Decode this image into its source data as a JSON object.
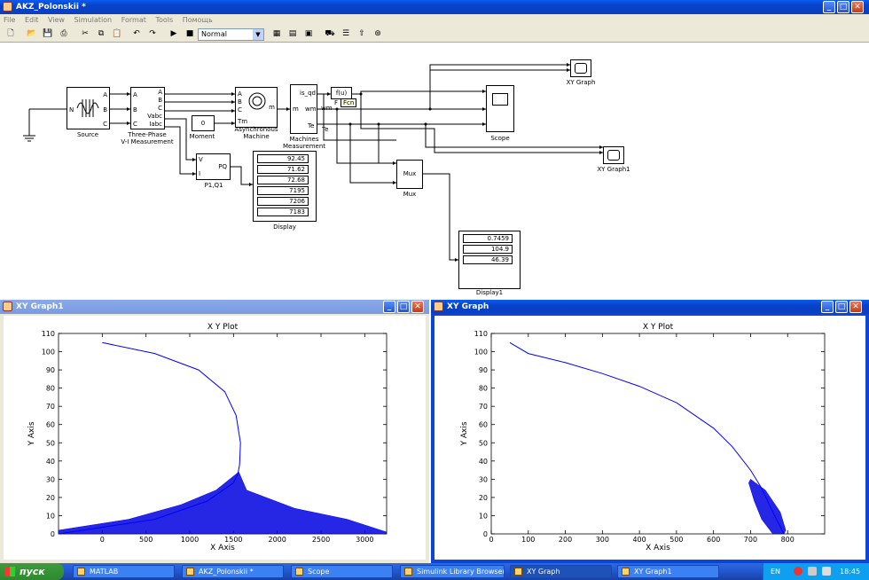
{
  "model_window": {
    "title": "AKZ_Polonskii *",
    "menu": [
      "File",
      "Edit",
      "View",
      "Simulation",
      "Format",
      "Tools",
      "Помощь"
    ],
    "sim_mode": "Normal",
    "blocks": {
      "source": {
        "label": "Source",
        "ports": [
          "N",
          "A",
          "B",
          "C"
        ]
      },
      "vi_meas": {
        "label": "Three-Phase\nV-I Measurement",
        "label_line1": "Three-Phase",
        "label_line2": "V-I Measurement",
        "ports_in": [
          "A",
          "B",
          "C"
        ],
        "ports_out": [
          "A",
          "B",
          "C",
          "Vabc",
          "Iabc"
        ]
      },
      "moment": {
        "label": "Moment",
        "value": "0"
      },
      "async_machine": {
        "label_line1": "Asynchronous",
        "label_line2": "Machine",
        "ports": [
          "A",
          "B",
          "C",
          "Tm",
          "m"
        ]
      },
      "machines_meas": {
        "label_line1": "Machines",
        "label_line2": "Measurement",
        "ports": [
          "m",
          "is_qd",
          "wm",
          "Te"
        ]
      },
      "fcn": {
        "label": "f(u)",
        "tooltip": "Fcn",
        "port": "F"
      },
      "pq": {
        "label": "P1,Q1",
        "ports": [
          "V",
          "I",
          "PQ"
        ]
      },
      "display": {
        "label": "Display",
        "values": [
          "92.45",
          "71.62",
          "72.68",
          "7195",
          "7206",
          "7183"
        ]
      },
      "mux": {
        "label": "Mux",
        "inner": "Mux"
      },
      "display1": {
        "label": "Display1",
        "values": [
          "0.7459",
          "104.9",
          "46.39"
        ]
      },
      "scope": {
        "label": "Scope"
      },
      "xy_graph": {
        "label": "XY Graph"
      },
      "xy_graph1": {
        "label": "XY Graph1"
      }
    }
  },
  "xy_graph1_window": {
    "title": "XY Graph1",
    "plot_title": "X Y Plot",
    "xlabel": "X Axis",
    "ylabel": "Y Axis",
    "xticks": [
      "0",
      "500",
      "1000",
      "1500",
      "2000",
      "2500",
      "3000"
    ],
    "yticks": [
      "0",
      "10",
      "20",
      "30",
      "40",
      "50",
      "60",
      "70",
      "80",
      "90",
      "100",
      "110"
    ]
  },
  "xy_graph_window": {
    "title": "XY Graph",
    "plot_title": "X Y Plot",
    "xlabel": "X Axis",
    "ylabel": "Y Axis",
    "xticks": [
      "0",
      "100",
      "200",
      "300",
      "400",
      "500",
      "600",
      "700",
      "800"
    ],
    "yticks": [
      "0",
      "10",
      "20",
      "30",
      "40",
      "50",
      "60",
      "70",
      "80",
      "90",
      "100",
      "110"
    ]
  },
  "taskbar": {
    "start": "пуск",
    "tasks": [
      "MATLAB",
      "AKZ_Polonskii *",
      "Scope",
      "Simulink Library Browser",
      "XY Graph",
      "XY Graph1"
    ],
    "lang": "EN",
    "clock": "18:45"
  },
  "colors": {
    "titlebar": "#0a46d8",
    "plot_line": "#0000ff",
    "taskbar": "#245edb"
  },
  "chart_data": [
    {
      "type": "line",
      "title": "X Y Plot",
      "xlabel": "X Axis",
      "ylabel": "Y Axis",
      "xlim": [
        -500,
        3250
      ],
      "ylim": [
        0,
        110
      ],
      "series": [
        {
          "x": [
            0,
            600,
            1100,
            1400,
            1530,
            1580,
            1570,
            1550,
            1500,
            1200,
            600,
            -500
          ],
          "y": [
            105,
            99,
            90,
            78,
            65,
            50,
            38,
            33,
            28,
            18,
            8,
            0
          ]
        }
      ]
    },
    {
      "type": "line",
      "title": "X Y Plot",
      "xlabel": "X Axis",
      "ylabel": "Y Axis",
      "xlim": [
        0,
        900
      ],
      "ylim": [
        0,
        110
      ],
      "series": [
        {
          "x": [
            50,
            100,
            200,
            300,
            400,
            500,
            600,
            650,
            700,
            730,
            760,
            790
          ],
          "y": [
            105,
            99,
            94,
            88,
            81,
            72,
            58,
            48,
            35,
            25,
            12,
            0
          ]
        }
      ]
    }
  ]
}
